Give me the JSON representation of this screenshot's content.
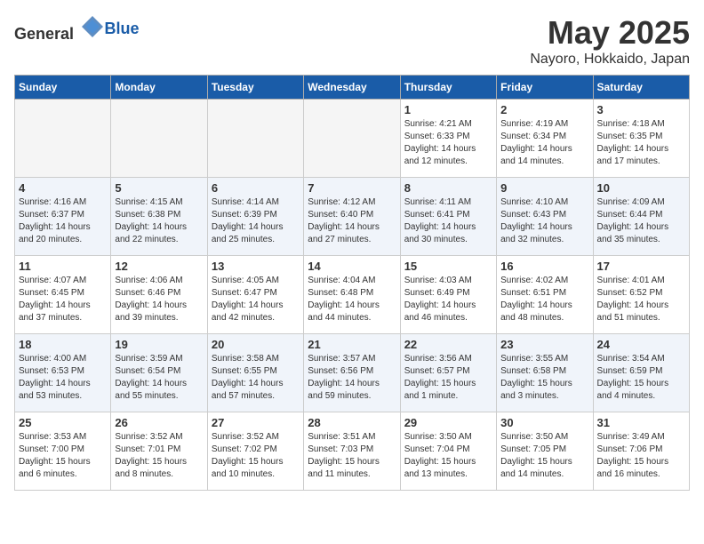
{
  "header": {
    "logo_general": "General",
    "logo_blue": "Blue",
    "month": "May 2025",
    "location": "Nayoro, Hokkaido, Japan"
  },
  "days_of_week": [
    "Sunday",
    "Monday",
    "Tuesday",
    "Wednesday",
    "Thursday",
    "Friday",
    "Saturday"
  ],
  "weeks": [
    [
      {
        "day": "",
        "info": ""
      },
      {
        "day": "",
        "info": ""
      },
      {
        "day": "",
        "info": ""
      },
      {
        "day": "",
        "info": ""
      },
      {
        "day": "1",
        "info": "Sunrise: 4:21 AM\nSunset: 6:33 PM\nDaylight: 14 hours\nand 12 minutes."
      },
      {
        "day": "2",
        "info": "Sunrise: 4:19 AM\nSunset: 6:34 PM\nDaylight: 14 hours\nand 14 minutes."
      },
      {
        "day": "3",
        "info": "Sunrise: 4:18 AM\nSunset: 6:35 PM\nDaylight: 14 hours\nand 17 minutes."
      }
    ],
    [
      {
        "day": "4",
        "info": "Sunrise: 4:16 AM\nSunset: 6:37 PM\nDaylight: 14 hours\nand 20 minutes."
      },
      {
        "day": "5",
        "info": "Sunrise: 4:15 AM\nSunset: 6:38 PM\nDaylight: 14 hours\nand 22 minutes."
      },
      {
        "day": "6",
        "info": "Sunrise: 4:14 AM\nSunset: 6:39 PM\nDaylight: 14 hours\nand 25 minutes."
      },
      {
        "day": "7",
        "info": "Sunrise: 4:12 AM\nSunset: 6:40 PM\nDaylight: 14 hours\nand 27 minutes."
      },
      {
        "day": "8",
        "info": "Sunrise: 4:11 AM\nSunset: 6:41 PM\nDaylight: 14 hours\nand 30 minutes."
      },
      {
        "day": "9",
        "info": "Sunrise: 4:10 AM\nSunset: 6:43 PM\nDaylight: 14 hours\nand 32 minutes."
      },
      {
        "day": "10",
        "info": "Sunrise: 4:09 AM\nSunset: 6:44 PM\nDaylight: 14 hours\nand 35 minutes."
      }
    ],
    [
      {
        "day": "11",
        "info": "Sunrise: 4:07 AM\nSunset: 6:45 PM\nDaylight: 14 hours\nand 37 minutes."
      },
      {
        "day": "12",
        "info": "Sunrise: 4:06 AM\nSunset: 6:46 PM\nDaylight: 14 hours\nand 39 minutes."
      },
      {
        "day": "13",
        "info": "Sunrise: 4:05 AM\nSunset: 6:47 PM\nDaylight: 14 hours\nand 42 minutes."
      },
      {
        "day": "14",
        "info": "Sunrise: 4:04 AM\nSunset: 6:48 PM\nDaylight: 14 hours\nand 44 minutes."
      },
      {
        "day": "15",
        "info": "Sunrise: 4:03 AM\nSunset: 6:49 PM\nDaylight: 14 hours\nand 46 minutes."
      },
      {
        "day": "16",
        "info": "Sunrise: 4:02 AM\nSunset: 6:51 PM\nDaylight: 14 hours\nand 48 minutes."
      },
      {
        "day": "17",
        "info": "Sunrise: 4:01 AM\nSunset: 6:52 PM\nDaylight: 14 hours\nand 51 minutes."
      }
    ],
    [
      {
        "day": "18",
        "info": "Sunrise: 4:00 AM\nSunset: 6:53 PM\nDaylight: 14 hours\nand 53 minutes."
      },
      {
        "day": "19",
        "info": "Sunrise: 3:59 AM\nSunset: 6:54 PM\nDaylight: 14 hours\nand 55 minutes."
      },
      {
        "day": "20",
        "info": "Sunrise: 3:58 AM\nSunset: 6:55 PM\nDaylight: 14 hours\nand 57 minutes."
      },
      {
        "day": "21",
        "info": "Sunrise: 3:57 AM\nSunset: 6:56 PM\nDaylight: 14 hours\nand 59 minutes."
      },
      {
        "day": "22",
        "info": "Sunrise: 3:56 AM\nSunset: 6:57 PM\nDaylight: 15 hours\nand 1 minute."
      },
      {
        "day": "23",
        "info": "Sunrise: 3:55 AM\nSunset: 6:58 PM\nDaylight: 15 hours\nand 3 minutes."
      },
      {
        "day": "24",
        "info": "Sunrise: 3:54 AM\nSunset: 6:59 PM\nDaylight: 15 hours\nand 4 minutes."
      }
    ],
    [
      {
        "day": "25",
        "info": "Sunrise: 3:53 AM\nSunset: 7:00 PM\nDaylight: 15 hours\nand 6 minutes."
      },
      {
        "day": "26",
        "info": "Sunrise: 3:52 AM\nSunset: 7:01 PM\nDaylight: 15 hours\nand 8 minutes."
      },
      {
        "day": "27",
        "info": "Sunrise: 3:52 AM\nSunset: 7:02 PM\nDaylight: 15 hours\nand 10 minutes."
      },
      {
        "day": "28",
        "info": "Sunrise: 3:51 AM\nSunset: 7:03 PM\nDaylight: 15 hours\nand 11 minutes."
      },
      {
        "day": "29",
        "info": "Sunrise: 3:50 AM\nSunset: 7:04 PM\nDaylight: 15 hours\nand 13 minutes."
      },
      {
        "day": "30",
        "info": "Sunrise: 3:50 AM\nSunset: 7:05 PM\nDaylight: 15 hours\nand 14 minutes."
      },
      {
        "day": "31",
        "info": "Sunrise: 3:49 AM\nSunset: 7:06 PM\nDaylight: 15 hours\nand 16 minutes."
      }
    ]
  ]
}
